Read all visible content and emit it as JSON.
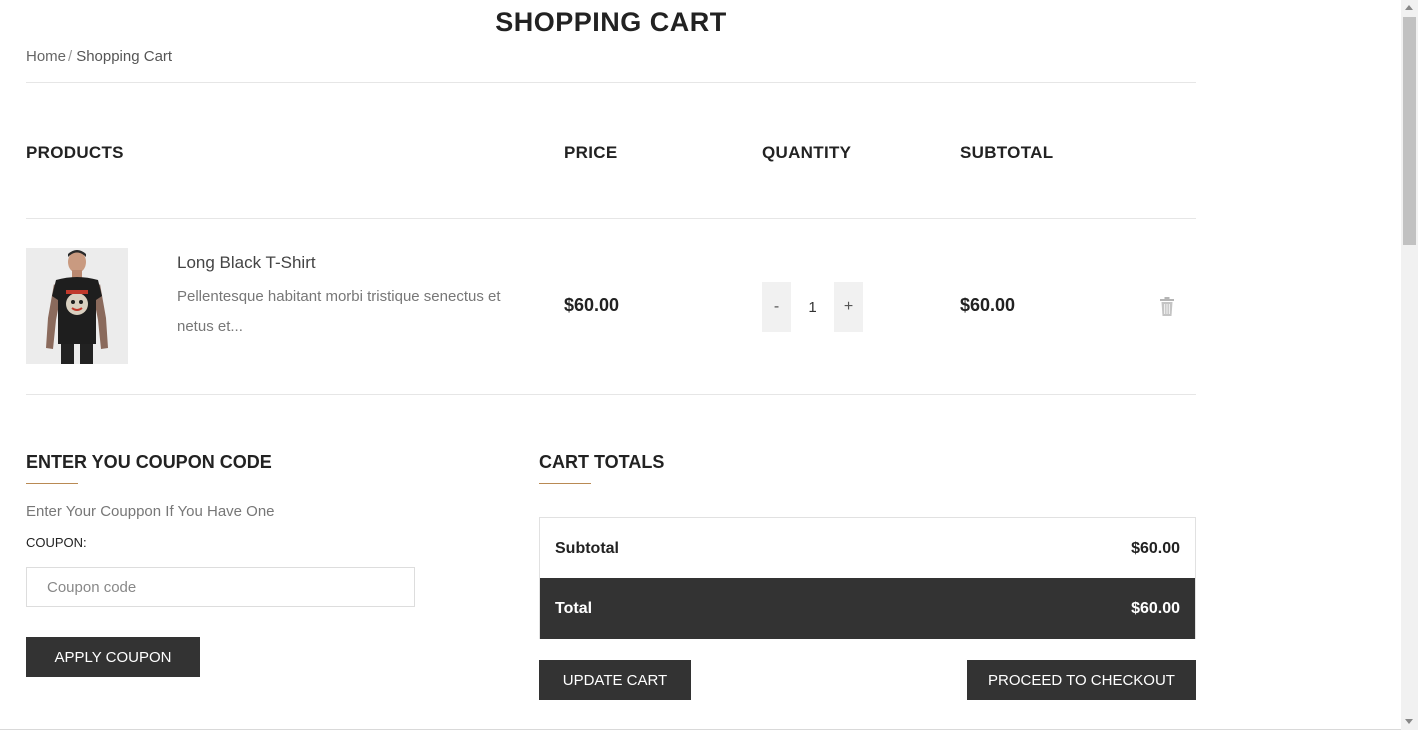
{
  "page": {
    "title": "SHOPPING CART"
  },
  "breadcrumb": {
    "home": "Home",
    "separator": "/",
    "current": "Shopping Cart"
  },
  "table": {
    "headers": {
      "products": "PRODUCTS",
      "price": "PRICE",
      "quantity": "QUANTITY",
      "subtotal": "SUBTOTAL"
    },
    "items": [
      {
        "name": "Long Black T-Shirt",
        "description": "Pellentesque habitant morbi tristique senectus et netus et...",
        "price": "$60.00",
        "quantity": "1",
        "subtotal": "$60.00",
        "decrement": "-",
        "increment": "+"
      }
    ]
  },
  "coupon": {
    "heading": "ENTER YOU COUPON CODE",
    "text": "Enter Your Couppon If You Have One",
    "label": "COUPON:",
    "placeholder": "Coupon code",
    "apply_label": "APPLY COUPON"
  },
  "totals": {
    "heading": "CART TOTALS",
    "subtotal_label": "Subtotal",
    "subtotal_value": "$60.00",
    "total_label": "Total",
    "total_value": "$60.00",
    "update_label": "UPDATE CART",
    "checkout_label": "PROCEED TO CHECKOUT"
  },
  "icons": {
    "remove": "trash-icon",
    "product_image": "t-shirt-model-image"
  },
  "colors": {
    "accent_underline": "#b98a54",
    "dark": "#333333",
    "text": "#222222",
    "muted": "#777777"
  }
}
